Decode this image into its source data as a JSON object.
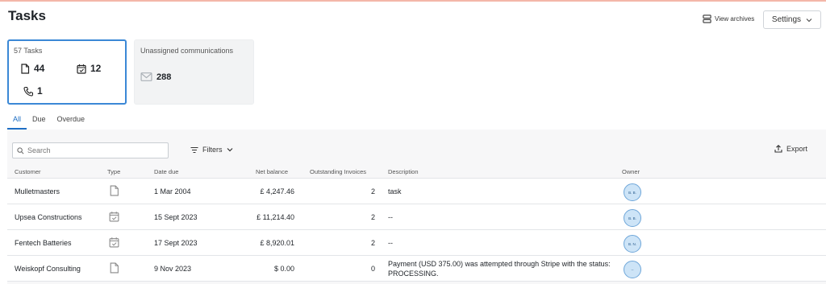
{
  "page": {
    "title": "Tasks"
  },
  "header": {
    "view_archives": "View archives",
    "settings": "Settings"
  },
  "cards": {
    "tasks": {
      "title": "57 Tasks",
      "documents": "44",
      "scheduled": "12",
      "calls": "1"
    },
    "unassigned": {
      "title": "Unassigned communications",
      "count": "288"
    }
  },
  "tabs": [
    "All",
    "Due",
    "Overdue"
  ],
  "toolbar": {
    "search_placeholder": "Search",
    "filters": "Filters",
    "export": "Export"
  },
  "table": {
    "columns": {
      "customer": "Customer",
      "type": "Type",
      "date_due": "Date due",
      "net_balance": "Net balance",
      "outstanding": "Outstanding Invoices",
      "description": "Description",
      "owner": "Owner"
    },
    "rows": [
      {
        "customer": "Mulletmasters",
        "type_icon": "document-icon",
        "date_due": "1 Mar 2004",
        "net_balance": "£ 4,247.46",
        "outstanding": "2",
        "description": "task",
        "owner": "B. B."
      },
      {
        "customer": "Upsea Constructions",
        "type_icon": "calendar-check-icon",
        "date_due": "15 Sept 2023",
        "net_balance": "£ 11,214.40",
        "outstanding": "2",
        "description": "--",
        "owner": "B. B."
      },
      {
        "customer": "Fentech Batteries",
        "type_icon": "calendar-check-icon",
        "date_due": "17 Sept 2023",
        "net_balance": "£ 8,920.01",
        "outstanding": "2",
        "description": "--",
        "owner": "B. N."
      },
      {
        "customer": "Weiskopf Consulting",
        "type_icon": "document-icon",
        "date_due": "9 Nov 2023",
        "net_balance": "$ 0.00",
        "outstanding": "0",
        "description": "Payment (USD 375.00) was attempted through Stripe with the status: PROCESSING.",
        "owner": "--"
      }
    ]
  },
  "colors": {
    "accent": "#1f6fc4",
    "card_border": "#3b88d6",
    "avatar_bg": "#cde4f7",
    "top_stripe": "#f4b7a8"
  }
}
